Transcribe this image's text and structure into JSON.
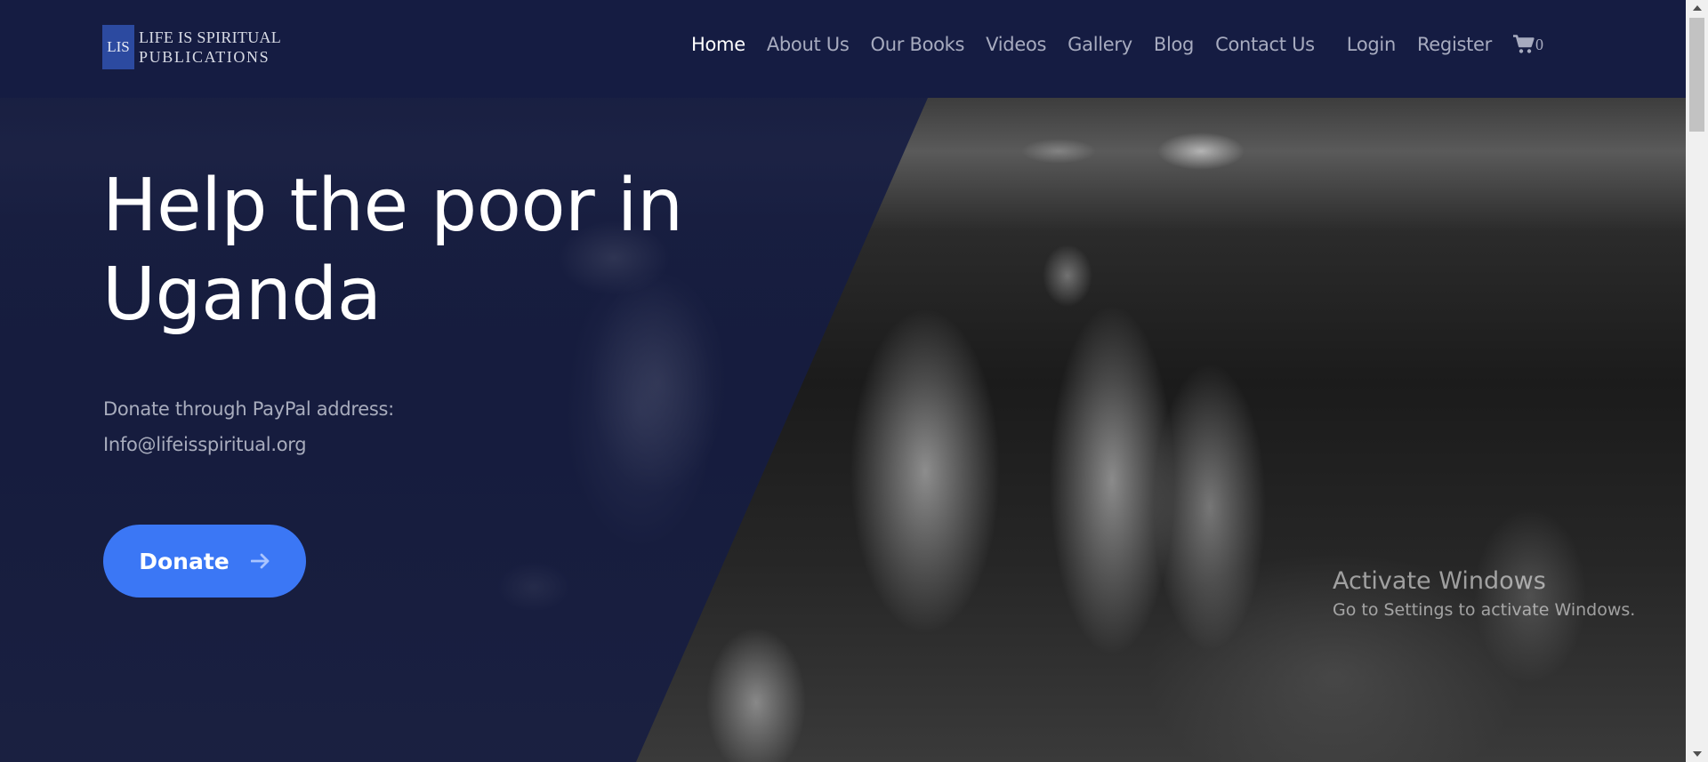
{
  "brand": {
    "logo_mark": "LIS",
    "line1": "LIFE IS SPIRITUAL",
    "line2": "PUBLICATIONS"
  },
  "nav": {
    "items": [
      {
        "label": "Home",
        "active": true
      },
      {
        "label": "About Us"
      },
      {
        "label": "Our Books"
      },
      {
        "label": "Videos"
      },
      {
        "label": "Gallery"
      },
      {
        "label": "Blog"
      },
      {
        "label": "Contact Us"
      }
    ],
    "login": "Login",
    "register": "Register",
    "cart_icon": "shopping-cart-icon",
    "cart_count": "0"
  },
  "hero": {
    "title_line1": "Help the poor in",
    "title_line2": "Uganda",
    "sub_line1": "Donate through PayPal address:",
    "sub_line2": "Info@lifeisspiritual.org",
    "donate_label": "Donate",
    "donate_icon": "arrow-right-icon"
  },
  "watermark": {
    "line1": "Activate Windows",
    "line2": "Go to Settings to activate Windows."
  },
  "colors": {
    "header_bg": "#151c42",
    "accent": "#3b77f5",
    "nav_text": "#a7abbf",
    "nav_active": "#ffffff"
  }
}
